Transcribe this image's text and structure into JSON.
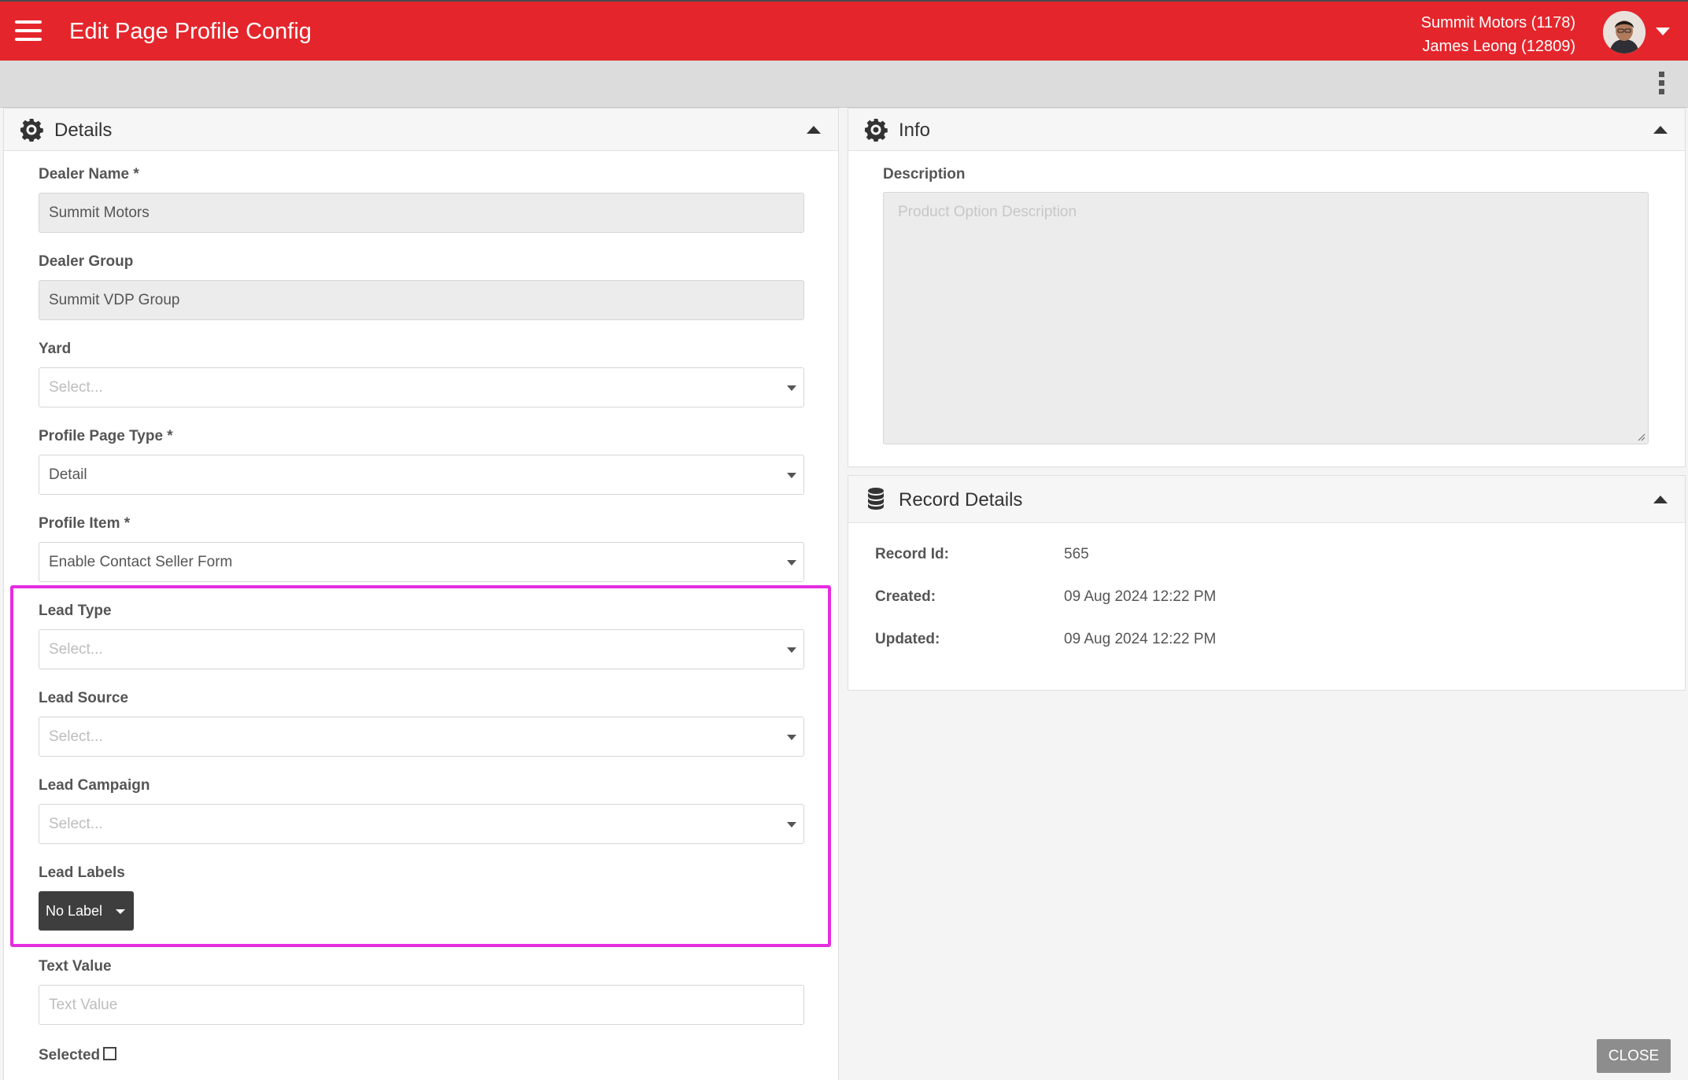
{
  "header": {
    "title": "Edit Page Profile Config",
    "dealer": "Summit Motors (1178)",
    "user": "James Leong (12809)"
  },
  "details": {
    "title": "Details",
    "dealer_name": {
      "label": "Dealer Name *",
      "value": "Summit Motors"
    },
    "dealer_group": {
      "label": "Dealer Group",
      "value": "Summit VDP Group"
    },
    "yard": {
      "label": "Yard",
      "placeholder": "Select..."
    },
    "profile_page_type": {
      "label": "Profile Page Type *",
      "value": "Detail"
    },
    "profile_item": {
      "label": "Profile Item *",
      "value": "Enable Contact Seller Form"
    },
    "lead_type": {
      "label": "Lead Type",
      "placeholder": "Select..."
    },
    "lead_source": {
      "label": "Lead Source",
      "placeholder": "Select..."
    },
    "lead_campaign": {
      "label": "Lead Campaign",
      "placeholder": "Select..."
    },
    "lead_labels": {
      "label": "Lead Labels",
      "button": "No Label"
    },
    "text_value": {
      "label": "Text Value",
      "placeholder": "Text Value"
    },
    "selected": {
      "label": "Selected",
      "checked": false
    }
  },
  "info": {
    "title": "Info",
    "description": {
      "label": "Description",
      "placeholder": "Product Option Description"
    }
  },
  "record_details": {
    "title": "Record Details",
    "rows": [
      {
        "key": "Record Id:",
        "value": "565"
      },
      {
        "key": "Created:",
        "value": "09 Aug 2024 12:22 PM"
      },
      {
        "key": "Updated:",
        "value": "09 Aug 2024 12:22 PM"
      }
    ]
  },
  "footer": {
    "close_label": "CLOSE"
  },
  "colors": {
    "header_bg": "#e4262c",
    "highlight": "#e52de0",
    "label_button_bg": "#3e3e3e",
    "close_bg": "#8d8d8d"
  },
  "icons": {
    "menu": "hamburger-icon",
    "details": "gear-icon",
    "info": "gear-icon",
    "record_details": "database-icon",
    "more": "kebab-icon"
  }
}
